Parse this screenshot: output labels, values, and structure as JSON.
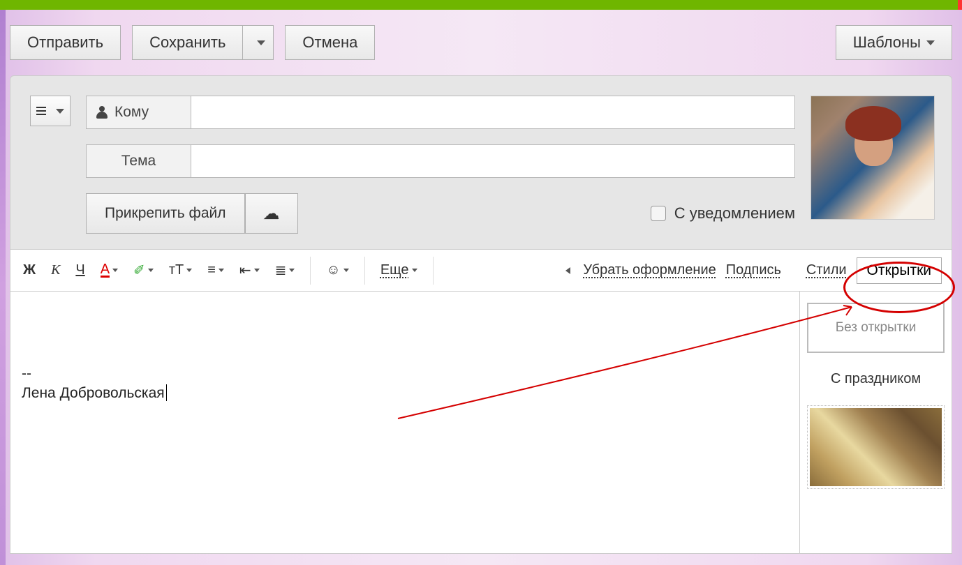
{
  "actions": {
    "send": "Отправить",
    "save": "Сохранить",
    "cancel": "Отмена",
    "templates": "Шаблоны"
  },
  "fields": {
    "to_label": "Кому",
    "subject_label": "Тема",
    "to_value": "",
    "subject_value": ""
  },
  "attach": {
    "label": "Прикрепить файл"
  },
  "notify": {
    "label": "С уведомлением"
  },
  "toolbar": {
    "bold": "Ж",
    "italic": "К",
    "underline": "Ч",
    "color": "А",
    "fontsize": "тТ",
    "more": "Еще",
    "remove_formatting": "Убрать оформление",
    "signature": "Подпись",
    "styles": "Стили",
    "postcards": "Открытки"
  },
  "editor": {
    "separator": "--",
    "signature": "Лена Добровольская"
  },
  "postcards": {
    "none": "Без открытки",
    "category": "С праздником"
  }
}
